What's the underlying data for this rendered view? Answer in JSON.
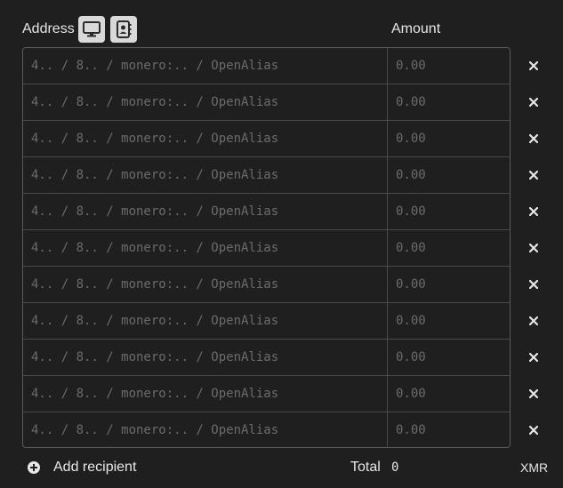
{
  "header": {
    "address_label": "Address",
    "amount_label": "Amount",
    "icons": [
      "computer-icon",
      "address-book-icon"
    ]
  },
  "recipients": [
    {
      "address_placeholder": "4.. / 8.. / monero:.. / OpenAlias",
      "amount_placeholder": "0.00"
    },
    {
      "address_placeholder": "4.. / 8.. / monero:.. / OpenAlias",
      "amount_placeholder": "0.00"
    },
    {
      "address_placeholder": "4.. / 8.. / monero:.. / OpenAlias",
      "amount_placeholder": "0.00"
    },
    {
      "address_placeholder": "4.. / 8.. / monero:.. / OpenAlias",
      "amount_placeholder": "0.00"
    },
    {
      "address_placeholder": "4.. / 8.. / monero:.. / OpenAlias",
      "amount_placeholder": "0.00"
    },
    {
      "address_placeholder": "4.. / 8.. / monero:.. / OpenAlias",
      "amount_placeholder": "0.00"
    },
    {
      "address_placeholder": "4.. / 8.. / monero:.. / OpenAlias",
      "amount_placeholder": "0.00"
    },
    {
      "address_placeholder": "4.. / 8.. / monero:.. / OpenAlias",
      "amount_placeholder": "0.00"
    },
    {
      "address_placeholder": "4.. / 8.. / monero:.. / OpenAlias",
      "amount_placeholder": "0.00"
    },
    {
      "address_placeholder": "4.. / 8.. / monero:.. / OpenAlias",
      "amount_placeholder": "0.00"
    },
    {
      "address_placeholder": "4.. / 8.. / monero:.. / OpenAlias",
      "amount_placeholder": "0.00"
    }
  ],
  "footer": {
    "add_label": "Add recipient",
    "total_label": "Total",
    "total_value": "0",
    "currency": "XMR"
  },
  "colors": {
    "background": "#1f1f1f",
    "border": "#5a5a5a",
    "text": "#e6e6e6",
    "placeholder": "#6b6b6b",
    "icon_button": "#d9d9d9"
  }
}
